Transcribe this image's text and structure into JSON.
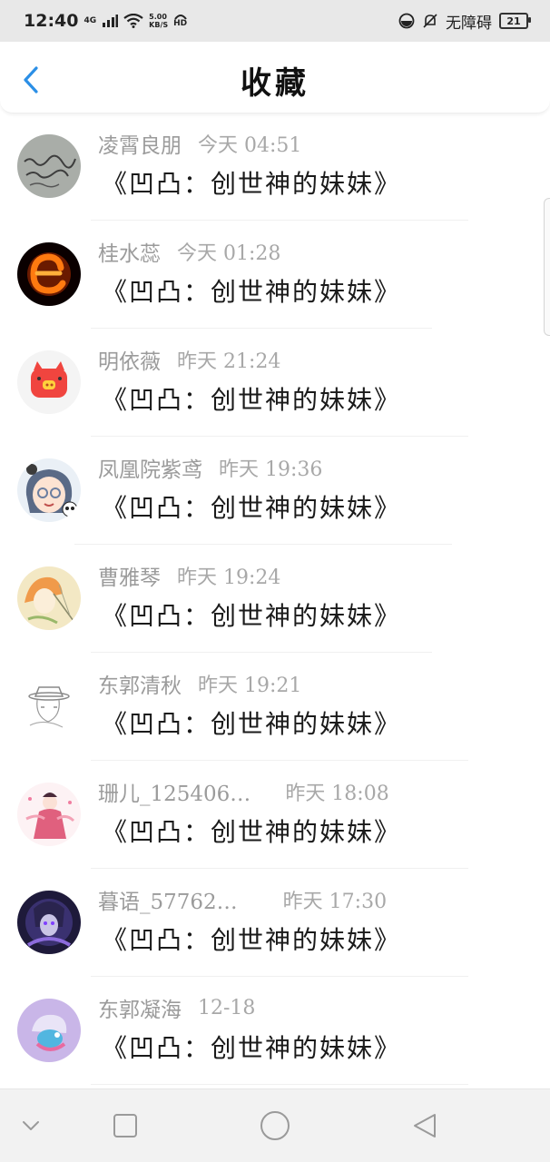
{
  "status_bar": {
    "time": "12:40",
    "network": "4G",
    "speed_value": "5.00",
    "speed_unit": "KB/S",
    "hd": "HD",
    "accessibility": "无障碍",
    "battery": "21"
  },
  "header": {
    "title": "收藏",
    "back_icon": "chevron-left-icon"
  },
  "colors": {
    "accent": "#2b8fe6",
    "name": "#9b9b9b",
    "title": "#1a1a1a",
    "status_bg": "#e8e8e8"
  },
  "items": [
    {
      "user": "凌霄良朋",
      "time": "今天 04:51",
      "title": "《凹凸：创世神的妹妹》",
      "avatar": "handwriting-avatar"
    },
    {
      "user": "桂水蕊",
      "time": "今天 01:28",
      "title": "《凹凸：创世神的妹妹》",
      "avatar": "fire-e-avatar"
    },
    {
      "user": "明依薇",
      "time": "昨天 21:24",
      "title": "《凹凸：创世神的妹妹》",
      "avatar": "pig-avatar"
    },
    {
      "user": "凤凰院紫鸢",
      "time": "昨天 19:36",
      "title": "《凹凸：创世神的妹妹》",
      "avatar": "anime-girl-avatar"
    },
    {
      "user": "曹雅琴",
      "time": "昨天 19:24",
      "title": "《凹凸：创世神的妹妹》",
      "avatar": "sketch-avatar"
    },
    {
      "user": "东郭清秋",
      "time": "昨天 19:21",
      "title": "《凹凸：创世神的妹妹》",
      "avatar": "line-art-avatar"
    },
    {
      "user": "珊儿_125406…",
      "time": "昨天 18:08",
      "title": "《凹凸：创世神的妹妹》",
      "avatar": "dancer-avatar"
    },
    {
      "user": "暮语_57762…",
      "time": "昨天 17:30",
      "title": "《凹凸：创世神的妹妹》",
      "avatar": "dark-character-avatar"
    },
    {
      "user": "东郭凝海",
      "time": "12-18",
      "title": "《凹凸：创世神的妹妹》",
      "avatar": "pastel-avatar"
    }
  ],
  "nav": {
    "down": "chevron-down-icon",
    "recent": "square-icon",
    "home": "circle-icon",
    "back": "triangle-back-icon"
  }
}
